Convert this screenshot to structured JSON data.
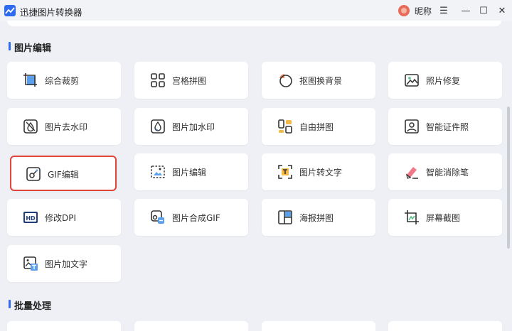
{
  "app": {
    "title": "迅捷图片转换器",
    "user_name": "昵称"
  },
  "window_controls": {
    "menu": "☰",
    "minimize": "—",
    "maximize": "☐",
    "close": "✕"
  },
  "sections": [
    {
      "title": "图片编辑",
      "tools": [
        {
          "label": "综合裁剪",
          "icon": "crop-icon"
        },
        {
          "label": "宫格拼图",
          "icon": "grid-icon"
        },
        {
          "label": "抠图换背景",
          "icon": "cutout-icon"
        },
        {
          "label": "照片修复",
          "icon": "photo-repair-icon"
        },
        {
          "label": "图片去水印",
          "icon": "remove-watermark-icon"
        },
        {
          "label": "图片加水印",
          "icon": "add-watermark-icon"
        },
        {
          "label": "自由拼图",
          "icon": "free-collage-icon"
        },
        {
          "label": "智能证件照",
          "icon": "id-photo-icon"
        },
        {
          "label": "GIF编辑",
          "icon": "gif-edit-icon",
          "selected": true
        },
        {
          "label": "图片编辑",
          "icon": "image-edit-icon"
        },
        {
          "label": "图片转文字",
          "icon": "ocr-icon"
        },
        {
          "label": "智能消除笔",
          "icon": "eraser-pen-icon"
        },
        {
          "label": "修改DPI",
          "icon": "dpi-icon"
        },
        {
          "label": "图片合成GIF",
          "icon": "make-gif-icon"
        },
        {
          "label": "海报拼图",
          "icon": "poster-collage-icon"
        },
        {
          "label": "屏幕截图",
          "icon": "screenshot-icon"
        },
        {
          "label": "图片加文字",
          "icon": "add-text-icon"
        }
      ]
    },
    {
      "title": "批量处理"
    }
  ],
  "colors": {
    "accent": "#2f6bf1",
    "selected_border": "#e0453a",
    "background": "#eef0f5"
  }
}
